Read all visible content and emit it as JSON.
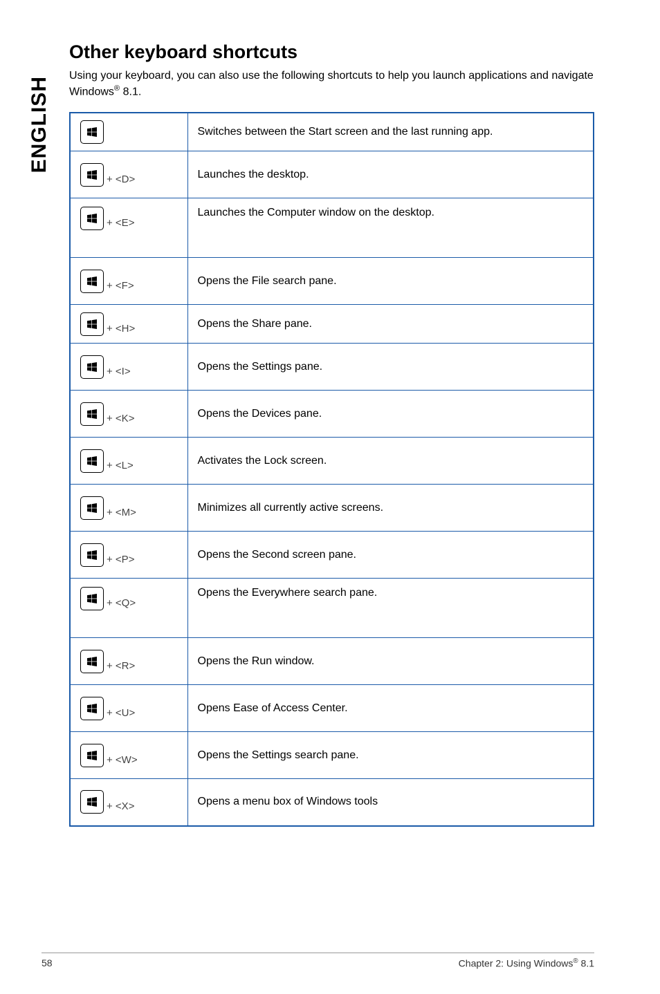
{
  "side_label": "ENGLISH",
  "heading": "Other keyboard shortcuts",
  "intro_a": "Using your keyboard, you can also use the following shortcuts to help you launch applications and navigate Windows",
  "intro_sup": "®",
  "intro_b": " 8.1.",
  "rows": [
    {
      "key_suffix": "",
      "row_class": "short",
      "desc": "Switches between the Start screen and the last running app."
    },
    {
      "key_suffix": " + <D>",
      "row_class": "med",
      "desc": "Launches the desktop."
    },
    {
      "key_suffix": " + <E>",
      "row_class": "tall",
      "desc": "Launches the Computer window on the desktop."
    },
    {
      "key_suffix": " + <F>",
      "row_class": "med",
      "desc": "Opens the File search pane."
    },
    {
      "key_suffix": " + <H>",
      "row_class": "short",
      "desc": "Opens the Share pane."
    },
    {
      "key_suffix": " + <I>",
      "row_class": "med",
      "desc": "Opens the Settings pane."
    },
    {
      "key_suffix": " + <K>",
      "row_class": "med",
      "desc": "Opens the Devices pane."
    },
    {
      "key_suffix": " + <L>",
      "row_class": "med",
      "desc": "Activates the Lock screen."
    },
    {
      "key_suffix": " + <M>",
      "row_class": "med",
      "desc": "Minimizes all currently active screens."
    },
    {
      "key_suffix": " + <P>",
      "row_class": "med",
      "desc": "Opens the Second screen pane."
    },
    {
      "key_suffix": " + <Q>",
      "row_class": "tall",
      "desc": "Opens the Everywhere search pane."
    },
    {
      "key_suffix": " + <R>",
      "row_class": "med",
      "desc": "Opens the Run window."
    },
    {
      "key_suffix": " + <U>",
      "row_class": "med",
      "desc": "Opens Ease of Access Center."
    },
    {
      "key_suffix": " + <W>",
      "row_class": "med",
      "desc": "Opens the Settings search pane."
    },
    {
      "key_suffix": " + <X>",
      "row_class": "med",
      "desc": "Opens a menu box of Windows tools"
    }
  ],
  "footer": {
    "page_number": "58",
    "chapter_a": "Chapter 2: Using Windows",
    "chapter_sup": "®",
    "chapter_b": " 8.1"
  }
}
